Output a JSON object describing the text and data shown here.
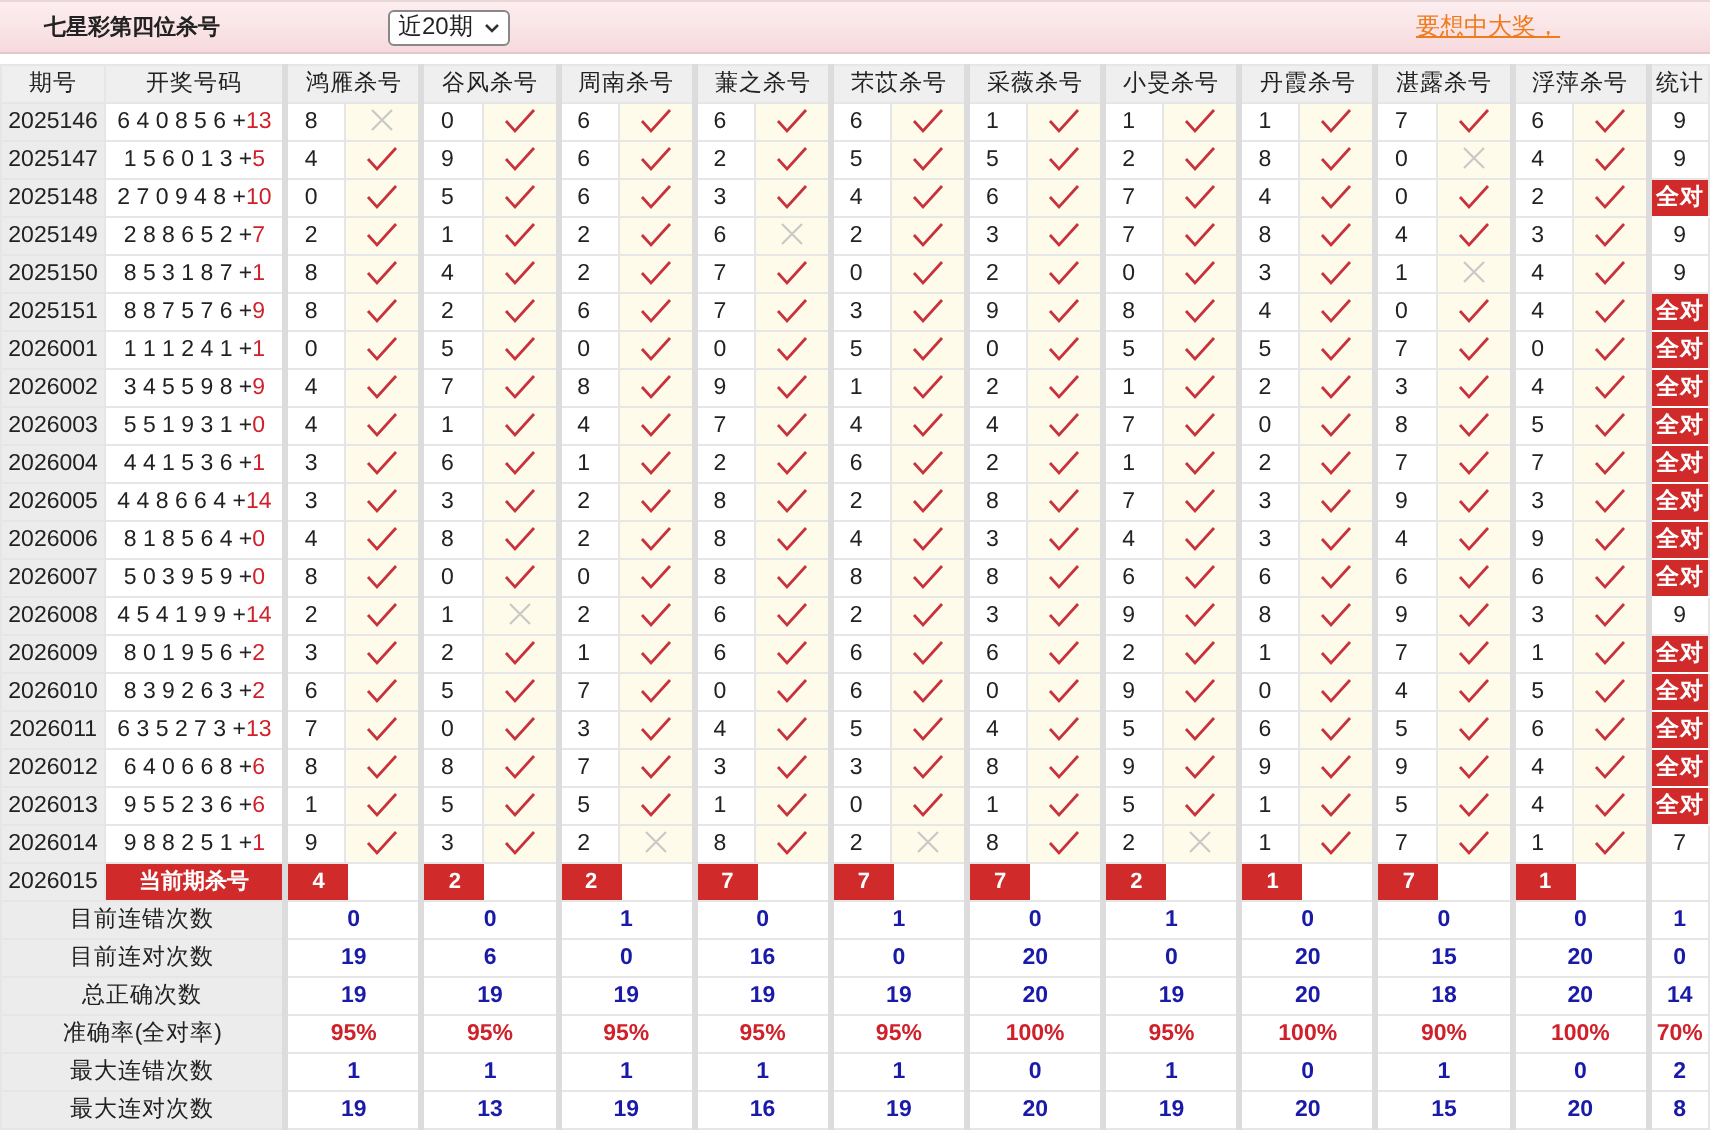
{
  "title": "七星彩第四位杀号",
  "period_select": {
    "value": "近20期"
  },
  "promo_link": "要想中大奖，",
  "columns": {
    "period": "期号",
    "numbers": "开奖号码",
    "predictors": [
      "鸿雁杀号",
      "谷风杀号",
      "周南杀号",
      "蒹之杀号",
      "芣苡杀号",
      "采薇杀号",
      "小旻杀号",
      "丹霞杀号",
      "湛露杀号",
      "浮萍杀号"
    ],
    "stat": "统计"
  },
  "rows": [
    {
      "period": "2025146",
      "numbers": "6 4 0 8 5 6 +",
      "sum": "13",
      "picks": [
        {
          "value": "8",
          "ok": false
        },
        {
          "value": "0",
          "ok": true
        },
        {
          "value": "6",
          "ok": true
        },
        {
          "value": "6",
          "ok": true
        },
        {
          "value": "6",
          "ok": true
        },
        {
          "value": "1",
          "ok": true
        },
        {
          "value": "1",
          "ok": true
        },
        {
          "value": "1",
          "ok": true
        },
        {
          "value": "7",
          "ok": true
        },
        {
          "value": "6",
          "ok": true
        }
      ],
      "stat": {
        "kind": "plain",
        "text": "9"
      }
    },
    {
      "period": "2025147",
      "numbers": "1 5 6 0 1 3 +",
      "sum": "5",
      "picks": [
        {
          "value": "4",
          "ok": true
        },
        {
          "value": "9",
          "ok": true
        },
        {
          "value": "6",
          "ok": true
        },
        {
          "value": "2",
          "ok": true
        },
        {
          "value": "5",
          "ok": true
        },
        {
          "value": "5",
          "ok": true
        },
        {
          "value": "2",
          "ok": true
        },
        {
          "value": "8",
          "ok": true
        },
        {
          "value": "0",
          "ok": false
        },
        {
          "value": "4",
          "ok": true
        }
      ],
      "stat": {
        "kind": "plain",
        "text": "9"
      }
    },
    {
      "period": "2025148",
      "numbers": "2 7 0 9 4 8 +",
      "sum": "10",
      "picks": [
        {
          "value": "0",
          "ok": true
        },
        {
          "value": "5",
          "ok": true
        },
        {
          "value": "6",
          "ok": true
        },
        {
          "value": "3",
          "ok": true
        },
        {
          "value": "4",
          "ok": true
        },
        {
          "value": "6",
          "ok": true
        },
        {
          "value": "7",
          "ok": true
        },
        {
          "value": "4",
          "ok": true
        },
        {
          "value": "0",
          "ok": true
        },
        {
          "value": "2",
          "ok": true
        }
      ],
      "stat": {
        "kind": "badge",
        "text": "全对"
      }
    },
    {
      "period": "2025149",
      "numbers": "2 8 8 6 5 2 +",
      "sum": "7",
      "picks": [
        {
          "value": "2",
          "ok": true
        },
        {
          "value": "1",
          "ok": true
        },
        {
          "value": "2",
          "ok": true
        },
        {
          "value": "6",
          "ok": false
        },
        {
          "value": "2",
          "ok": true
        },
        {
          "value": "3",
          "ok": true
        },
        {
          "value": "7",
          "ok": true
        },
        {
          "value": "8",
          "ok": true
        },
        {
          "value": "4",
          "ok": true
        },
        {
          "value": "3",
          "ok": true
        }
      ],
      "stat": {
        "kind": "plain",
        "text": "9"
      }
    },
    {
      "period": "2025150",
      "numbers": "8 5 3 1 8 7 +",
      "sum": "1",
      "picks": [
        {
          "value": "8",
          "ok": true
        },
        {
          "value": "4",
          "ok": true
        },
        {
          "value": "2",
          "ok": true
        },
        {
          "value": "7",
          "ok": true
        },
        {
          "value": "0",
          "ok": true
        },
        {
          "value": "2",
          "ok": true
        },
        {
          "value": "0",
          "ok": true
        },
        {
          "value": "3",
          "ok": true
        },
        {
          "value": "1",
          "ok": false
        },
        {
          "value": "4",
          "ok": true
        }
      ],
      "stat": {
        "kind": "plain",
        "text": "9"
      }
    },
    {
      "period": "2025151",
      "numbers": "8 8 7 5 7 6 +",
      "sum": "9",
      "picks": [
        {
          "value": "8",
          "ok": true
        },
        {
          "value": "2",
          "ok": true
        },
        {
          "value": "6",
          "ok": true
        },
        {
          "value": "7",
          "ok": true
        },
        {
          "value": "3",
          "ok": true
        },
        {
          "value": "9",
          "ok": true
        },
        {
          "value": "8",
          "ok": true
        },
        {
          "value": "4",
          "ok": true
        },
        {
          "value": "0",
          "ok": true
        },
        {
          "value": "4",
          "ok": true
        }
      ],
      "stat": {
        "kind": "badge",
        "text": "全对"
      }
    },
    {
      "period": "2026001",
      "numbers": "1 1 1 2 4 1 +",
      "sum": "1",
      "picks": [
        {
          "value": "0",
          "ok": true
        },
        {
          "value": "5",
          "ok": true
        },
        {
          "value": "0",
          "ok": true
        },
        {
          "value": "0",
          "ok": true
        },
        {
          "value": "5",
          "ok": true
        },
        {
          "value": "0",
          "ok": true
        },
        {
          "value": "5",
          "ok": true
        },
        {
          "value": "5",
          "ok": true
        },
        {
          "value": "7",
          "ok": true
        },
        {
          "value": "0",
          "ok": true
        }
      ],
      "stat": {
        "kind": "badge",
        "text": "全对"
      }
    },
    {
      "period": "2026002",
      "numbers": "3 4 5 5 9 8 +",
      "sum": "9",
      "picks": [
        {
          "value": "4",
          "ok": true
        },
        {
          "value": "7",
          "ok": true
        },
        {
          "value": "8",
          "ok": true
        },
        {
          "value": "9",
          "ok": true
        },
        {
          "value": "1",
          "ok": true
        },
        {
          "value": "2",
          "ok": true
        },
        {
          "value": "1",
          "ok": true
        },
        {
          "value": "2",
          "ok": true
        },
        {
          "value": "3",
          "ok": true
        },
        {
          "value": "4",
          "ok": true
        }
      ],
      "stat": {
        "kind": "badge",
        "text": "全对"
      }
    },
    {
      "period": "2026003",
      "numbers": "5 5 1 9 3 1 +",
      "sum": "0",
      "picks": [
        {
          "value": "4",
          "ok": true
        },
        {
          "value": "1",
          "ok": true
        },
        {
          "value": "4",
          "ok": true
        },
        {
          "value": "7",
          "ok": true
        },
        {
          "value": "4",
          "ok": true
        },
        {
          "value": "4",
          "ok": true
        },
        {
          "value": "7",
          "ok": true
        },
        {
          "value": "0",
          "ok": true
        },
        {
          "value": "8",
          "ok": true
        },
        {
          "value": "5",
          "ok": true
        }
      ],
      "stat": {
        "kind": "badge",
        "text": "全对"
      }
    },
    {
      "period": "2026004",
      "numbers": "4 4 1 5 3 6 +",
      "sum": "1",
      "picks": [
        {
          "value": "3",
          "ok": true
        },
        {
          "value": "6",
          "ok": true
        },
        {
          "value": "1",
          "ok": true
        },
        {
          "value": "2",
          "ok": true
        },
        {
          "value": "6",
          "ok": true
        },
        {
          "value": "2",
          "ok": true
        },
        {
          "value": "1",
          "ok": true
        },
        {
          "value": "2",
          "ok": true
        },
        {
          "value": "7",
          "ok": true
        },
        {
          "value": "7",
          "ok": true
        }
      ],
      "stat": {
        "kind": "badge",
        "text": "全对"
      }
    },
    {
      "period": "2026005",
      "numbers": "4 4 8 6 6 4 +",
      "sum": "14",
      "picks": [
        {
          "value": "3",
          "ok": true
        },
        {
          "value": "3",
          "ok": true
        },
        {
          "value": "2",
          "ok": true
        },
        {
          "value": "8",
          "ok": true
        },
        {
          "value": "2",
          "ok": true
        },
        {
          "value": "8",
          "ok": true
        },
        {
          "value": "7",
          "ok": true
        },
        {
          "value": "3",
          "ok": true
        },
        {
          "value": "9",
          "ok": true
        },
        {
          "value": "3",
          "ok": true
        }
      ],
      "stat": {
        "kind": "badge",
        "text": "全对"
      }
    },
    {
      "period": "2026006",
      "numbers": "8 1 8 5 6 4 +",
      "sum": "0",
      "picks": [
        {
          "value": "4",
          "ok": true
        },
        {
          "value": "8",
          "ok": true
        },
        {
          "value": "2",
          "ok": true
        },
        {
          "value": "8",
          "ok": true
        },
        {
          "value": "4",
          "ok": true
        },
        {
          "value": "3",
          "ok": true
        },
        {
          "value": "4",
          "ok": true
        },
        {
          "value": "3",
          "ok": true
        },
        {
          "value": "4",
          "ok": true
        },
        {
          "value": "9",
          "ok": true
        }
      ],
      "stat": {
        "kind": "badge",
        "text": "全对"
      }
    },
    {
      "period": "2026007",
      "numbers": "5 0 3 9 5 9 +",
      "sum": "0",
      "picks": [
        {
          "value": "8",
          "ok": true
        },
        {
          "value": "0",
          "ok": true
        },
        {
          "value": "0",
          "ok": true
        },
        {
          "value": "8",
          "ok": true
        },
        {
          "value": "8",
          "ok": true
        },
        {
          "value": "8",
          "ok": true
        },
        {
          "value": "6",
          "ok": true
        },
        {
          "value": "6",
          "ok": true
        },
        {
          "value": "6",
          "ok": true
        },
        {
          "value": "6",
          "ok": true
        }
      ],
      "stat": {
        "kind": "badge",
        "text": "全对"
      }
    },
    {
      "period": "2026008",
      "numbers": "4 5 4 1 9 9 +",
      "sum": "14",
      "picks": [
        {
          "value": "2",
          "ok": true
        },
        {
          "value": "1",
          "ok": false
        },
        {
          "value": "2",
          "ok": true
        },
        {
          "value": "6",
          "ok": true
        },
        {
          "value": "2",
          "ok": true
        },
        {
          "value": "3",
          "ok": true
        },
        {
          "value": "9",
          "ok": true
        },
        {
          "value": "8",
          "ok": true
        },
        {
          "value": "9",
          "ok": true
        },
        {
          "value": "3",
          "ok": true
        }
      ],
      "stat": {
        "kind": "plain",
        "text": "9"
      }
    },
    {
      "period": "2026009",
      "numbers": "8 0 1 9 5 6 +",
      "sum": "2",
      "picks": [
        {
          "value": "3",
          "ok": true
        },
        {
          "value": "2",
          "ok": true
        },
        {
          "value": "1",
          "ok": true
        },
        {
          "value": "6",
          "ok": true
        },
        {
          "value": "6",
          "ok": true
        },
        {
          "value": "6",
          "ok": true
        },
        {
          "value": "2",
          "ok": true
        },
        {
          "value": "1",
          "ok": true
        },
        {
          "value": "7",
          "ok": true
        },
        {
          "value": "1",
          "ok": true
        }
      ],
      "stat": {
        "kind": "badge",
        "text": "全对"
      }
    },
    {
      "period": "2026010",
      "numbers": "8 3 9 2 6 3 +",
      "sum": "2",
      "picks": [
        {
          "value": "6",
          "ok": true
        },
        {
          "value": "5",
          "ok": true
        },
        {
          "value": "7",
          "ok": true
        },
        {
          "value": "0",
          "ok": true
        },
        {
          "value": "6",
          "ok": true
        },
        {
          "value": "0",
          "ok": true
        },
        {
          "value": "9",
          "ok": true
        },
        {
          "value": "0",
          "ok": true
        },
        {
          "value": "4",
          "ok": true
        },
        {
          "value": "5",
          "ok": true
        }
      ],
      "stat": {
        "kind": "badge",
        "text": "全对"
      }
    },
    {
      "period": "2026011",
      "numbers": "6 3 5 2 7 3 +",
      "sum": "13",
      "picks": [
        {
          "value": "7",
          "ok": true
        },
        {
          "value": "0",
          "ok": true
        },
        {
          "value": "3",
          "ok": true
        },
        {
          "value": "4",
          "ok": true
        },
        {
          "value": "5",
          "ok": true
        },
        {
          "value": "4",
          "ok": true
        },
        {
          "value": "5",
          "ok": true
        },
        {
          "value": "6",
          "ok": true
        },
        {
          "value": "5",
          "ok": true
        },
        {
          "value": "6",
          "ok": true
        }
      ],
      "stat": {
        "kind": "badge",
        "text": "全对"
      }
    },
    {
      "period": "2026012",
      "numbers": "6 4 0 6 6 8 +",
      "sum": "6",
      "picks": [
        {
          "value": "8",
          "ok": true
        },
        {
          "value": "8",
          "ok": true
        },
        {
          "value": "7",
          "ok": true
        },
        {
          "value": "3",
          "ok": true
        },
        {
          "value": "3",
          "ok": true
        },
        {
          "value": "8",
          "ok": true
        },
        {
          "value": "9",
          "ok": true
        },
        {
          "value": "9",
          "ok": true
        },
        {
          "value": "9",
          "ok": true
        },
        {
          "value": "4",
          "ok": true
        }
      ],
      "stat": {
        "kind": "badge",
        "text": "全对"
      }
    },
    {
      "period": "2026013",
      "numbers": "9 5 5 2 3 6 +",
      "sum": "6",
      "picks": [
        {
          "value": "1",
          "ok": true
        },
        {
          "value": "5",
          "ok": true
        },
        {
          "value": "5",
          "ok": true
        },
        {
          "value": "1",
          "ok": true
        },
        {
          "value": "0",
          "ok": true
        },
        {
          "value": "1",
          "ok": true
        },
        {
          "value": "5",
          "ok": true
        },
        {
          "value": "1",
          "ok": true
        },
        {
          "value": "5",
          "ok": true
        },
        {
          "value": "4",
          "ok": true
        }
      ],
      "stat": {
        "kind": "badge",
        "text": "全对"
      }
    },
    {
      "period": "2026014",
      "numbers": "9 8 8 2 5 1 +",
      "sum": "1",
      "picks": [
        {
          "value": "9",
          "ok": true
        },
        {
          "value": "3",
          "ok": true
        },
        {
          "value": "2",
          "ok": false
        },
        {
          "value": "8",
          "ok": true
        },
        {
          "value": "2",
          "ok": false
        },
        {
          "value": "8",
          "ok": true
        },
        {
          "value": "2",
          "ok": false
        },
        {
          "value": "1",
          "ok": true
        },
        {
          "value": "7",
          "ok": true
        },
        {
          "value": "1",
          "ok": true
        }
      ],
      "stat": {
        "kind": "plain",
        "text": "7"
      }
    }
  ],
  "current": {
    "period": "2026015",
    "label": "当前期杀号",
    "picks": [
      "4",
      "2",
      "2",
      "7",
      "7",
      "7",
      "2",
      "1",
      "7",
      "1"
    ]
  },
  "summary": [
    {
      "label": "目前连错次数",
      "kind": "count",
      "values": [
        "0",
        "0",
        "1",
        "0",
        "1",
        "0",
        "1",
        "0",
        "0",
        "0",
        "1"
      ]
    },
    {
      "label": "目前连对次数",
      "kind": "count",
      "values": [
        "19",
        "6",
        "0",
        "16",
        "0",
        "20",
        "0",
        "20",
        "15",
        "20",
        "0"
      ]
    },
    {
      "label": "总正确次数",
      "kind": "count",
      "values": [
        "19",
        "19",
        "19",
        "19",
        "19",
        "20",
        "19",
        "20",
        "18",
        "20",
        "14"
      ]
    },
    {
      "label": "准确率(全对率)",
      "kind": "rate",
      "values": [
        "95%",
        "95%",
        "95%",
        "95%",
        "95%",
        "100%",
        "95%",
        "100%",
        "90%",
        "100%",
        "70%"
      ]
    },
    {
      "label": "最大连错次数",
      "kind": "count",
      "values": [
        "1",
        "1",
        "1",
        "1",
        "1",
        "0",
        "1",
        "0",
        "1",
        "0",
        "2"
      ]
    },
    {
      "label": "最大连对次数",
      "kind": "count",
      "values": [
        "19",
        "13",
        "19",
        "16",
        "19",
        "20",
        "19",
        "20",
        "15",
        "20",
        "8"
      ]
    }
  ]
}
